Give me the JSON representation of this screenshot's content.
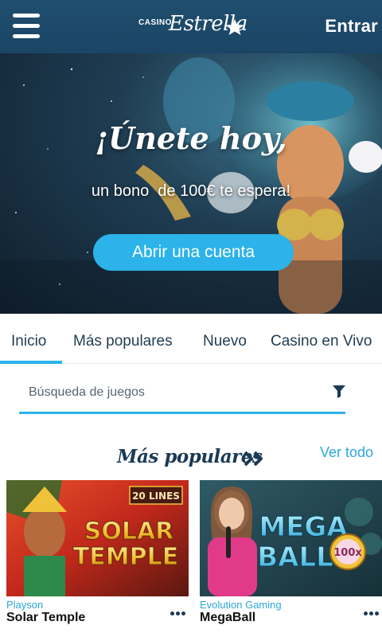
{
  "header": {
    "logo_small": "CASINO",
    "logo_script": "Estrella",
    "login_label": "Entrar"
  },
  "hero": {
    "title": "¡Únete hoy,",
    "subtitle": "un bono  de 100€ te espera!",
    "cta_label": "Abrir una cuenta"
  },
  "tabs": [
    {
      "label": "Inicio",
      "active": true
    },
    {
      "label": "Más populares",
      "active": false
    },
    {
      "label": "Nuevo",
      "active": false
    },
    {
      "label": "Casino en Vivo",
      "active": false
    }
  ],
  "search": {
    "placeholder": "Búsqueda de juegos"
  },
  "section": {
    "title": "Más populares",
    "see_all_label": "Ver todo"
  },
  "games": [
    {
      "provider": "Playson",
      "name": "Solar Temple",
      "thumb_line1": "SOLAR",
      "thumb_line2": "TEMPLE",
      "badge": "20 LINES"
    },
    {
      "provider": "Evolution Gaming",
      "name": "MegaBall",
      "thumb_line1": "MEGA",
      "thumb_line2": "BALL",
      "badge": "100x"
    }
  ],
  "colors": {
    "header_bg": "#1f4e6e",
    "accent": "#2bb3ea",
    "heading": "#1a3a55"
  },
  "icons": [
    "hamburger-menu-icon",
    "star-icon",
    "filter-icon",
    "double-chevron-right-icon",
    "more-dots-icon"
  ]
}
